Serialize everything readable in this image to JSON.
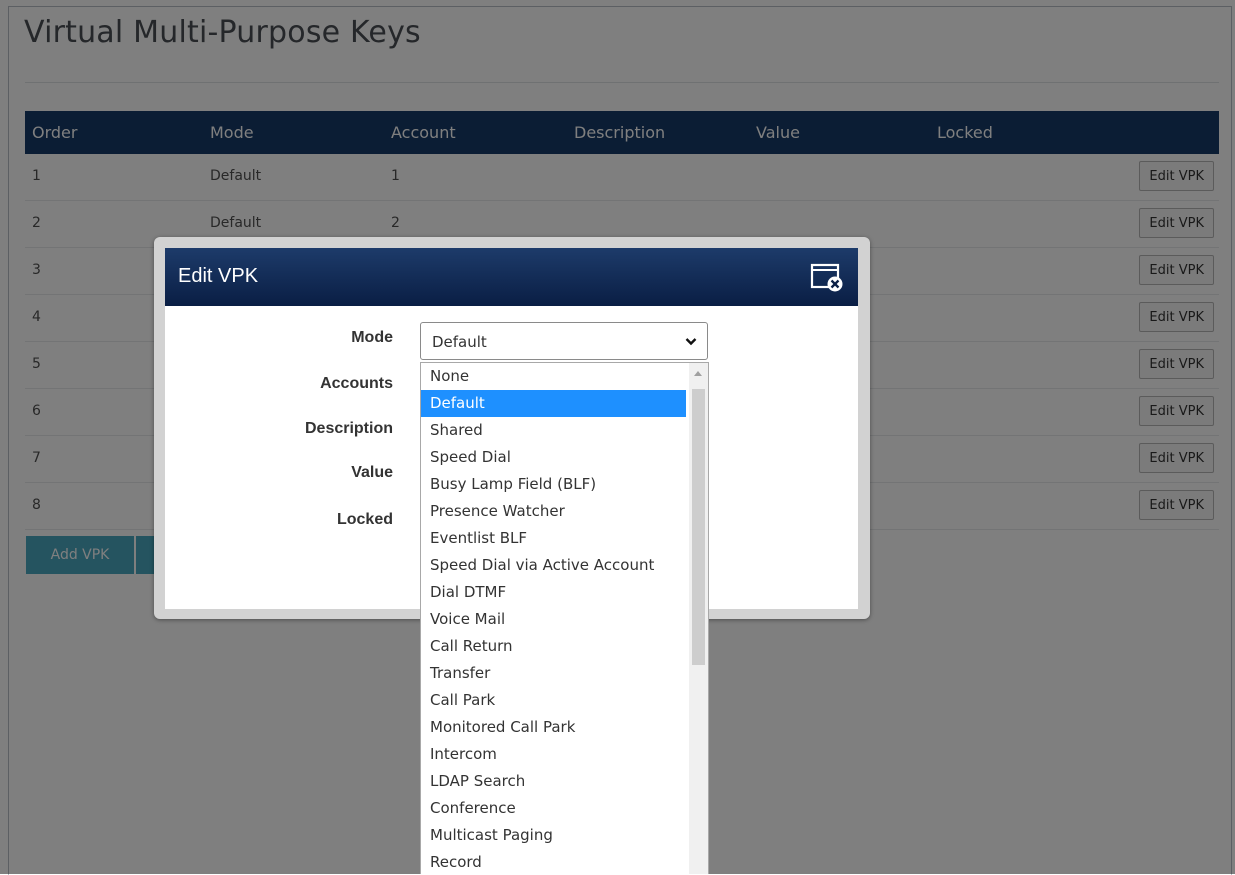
{
  "page": {
    "title": "Virtual Multi-Purpose Keys"
  },
  "table": {
    "headers": [
      "Order",
      "Mode",
      "Account",
      "Description",
      "Value",
      "Locked"
    ],
    "rows": [
      {
        "order": "1",
        "mode": "Default",
        "account": "1",
        "action": "Edit VPK"
      },
      {
        "order": "2",
        "mode": "Default",
        "account": "2",
        "action": "Edit VPK"
      },
      {
        "order": "3",
        "mode": "",
        "account": "",
        "action": "Edit VPK"
      },
      {
        "order": "4",
        "mode": "",
        "account": "",
        "action": "Edit VPK"
      },
      {
        "order": "5",
        "mode": "",
        "account": "",
        "action": "Edit VPK"
      },
      {
        "order": "6",
        "mode": "",
        "account": "",
        "action": "Edit VPK"
      },
      {
        "order": "7",
        "mode": "",
        "account": "",
        "action": "Edit VPK"
      },
      {
        "order": "8",
        "mode": "",
        "account": "",
        "action": "Edit VPK"
      }
    ]
  },
  "actions": {
    "add_vpk": "Add VPK"
  },
  "modal": {
    "title": "Edit VPK",
    "labels": {
      "mode": "Mode",
      "accounts": "Accounts",
      "description": "Description",
      "value": "Value",
      "locked": "Locked"
    },
    "mode_select": {
      "selected": "Default"
    }
  },
  "dropdown": {
    "options": [
      "None",
      "Default",
      "Shared",
      "Speed Dial",
      "Busy Lamp Field (BLF)",
      "Presence Watcher",
      "Eventlist BLF",
      "Speed Dial via Active Account",
      "Dial DTMF",
      "Voice Mail",
      "Call Return",
      "Transfer",
      "Call Park",
      "Monitored Call Park",
      "Intercom",
      "LDAP Search",
      "Conference",
      "Multicast Paging",
      "Record"
    ],
    "highlighted": "Default"
  },
  "colors": {
    "header": "#163a68",
    "accent": "#4aa8c1",
    "highlight": "#1e90ff"
  },
  "icons": {
    "close": "close-window-icon",
    "chevron": "chevron-down-icon",
    "scroll_up": "scroll-up-arrow-icon"
  }
}
